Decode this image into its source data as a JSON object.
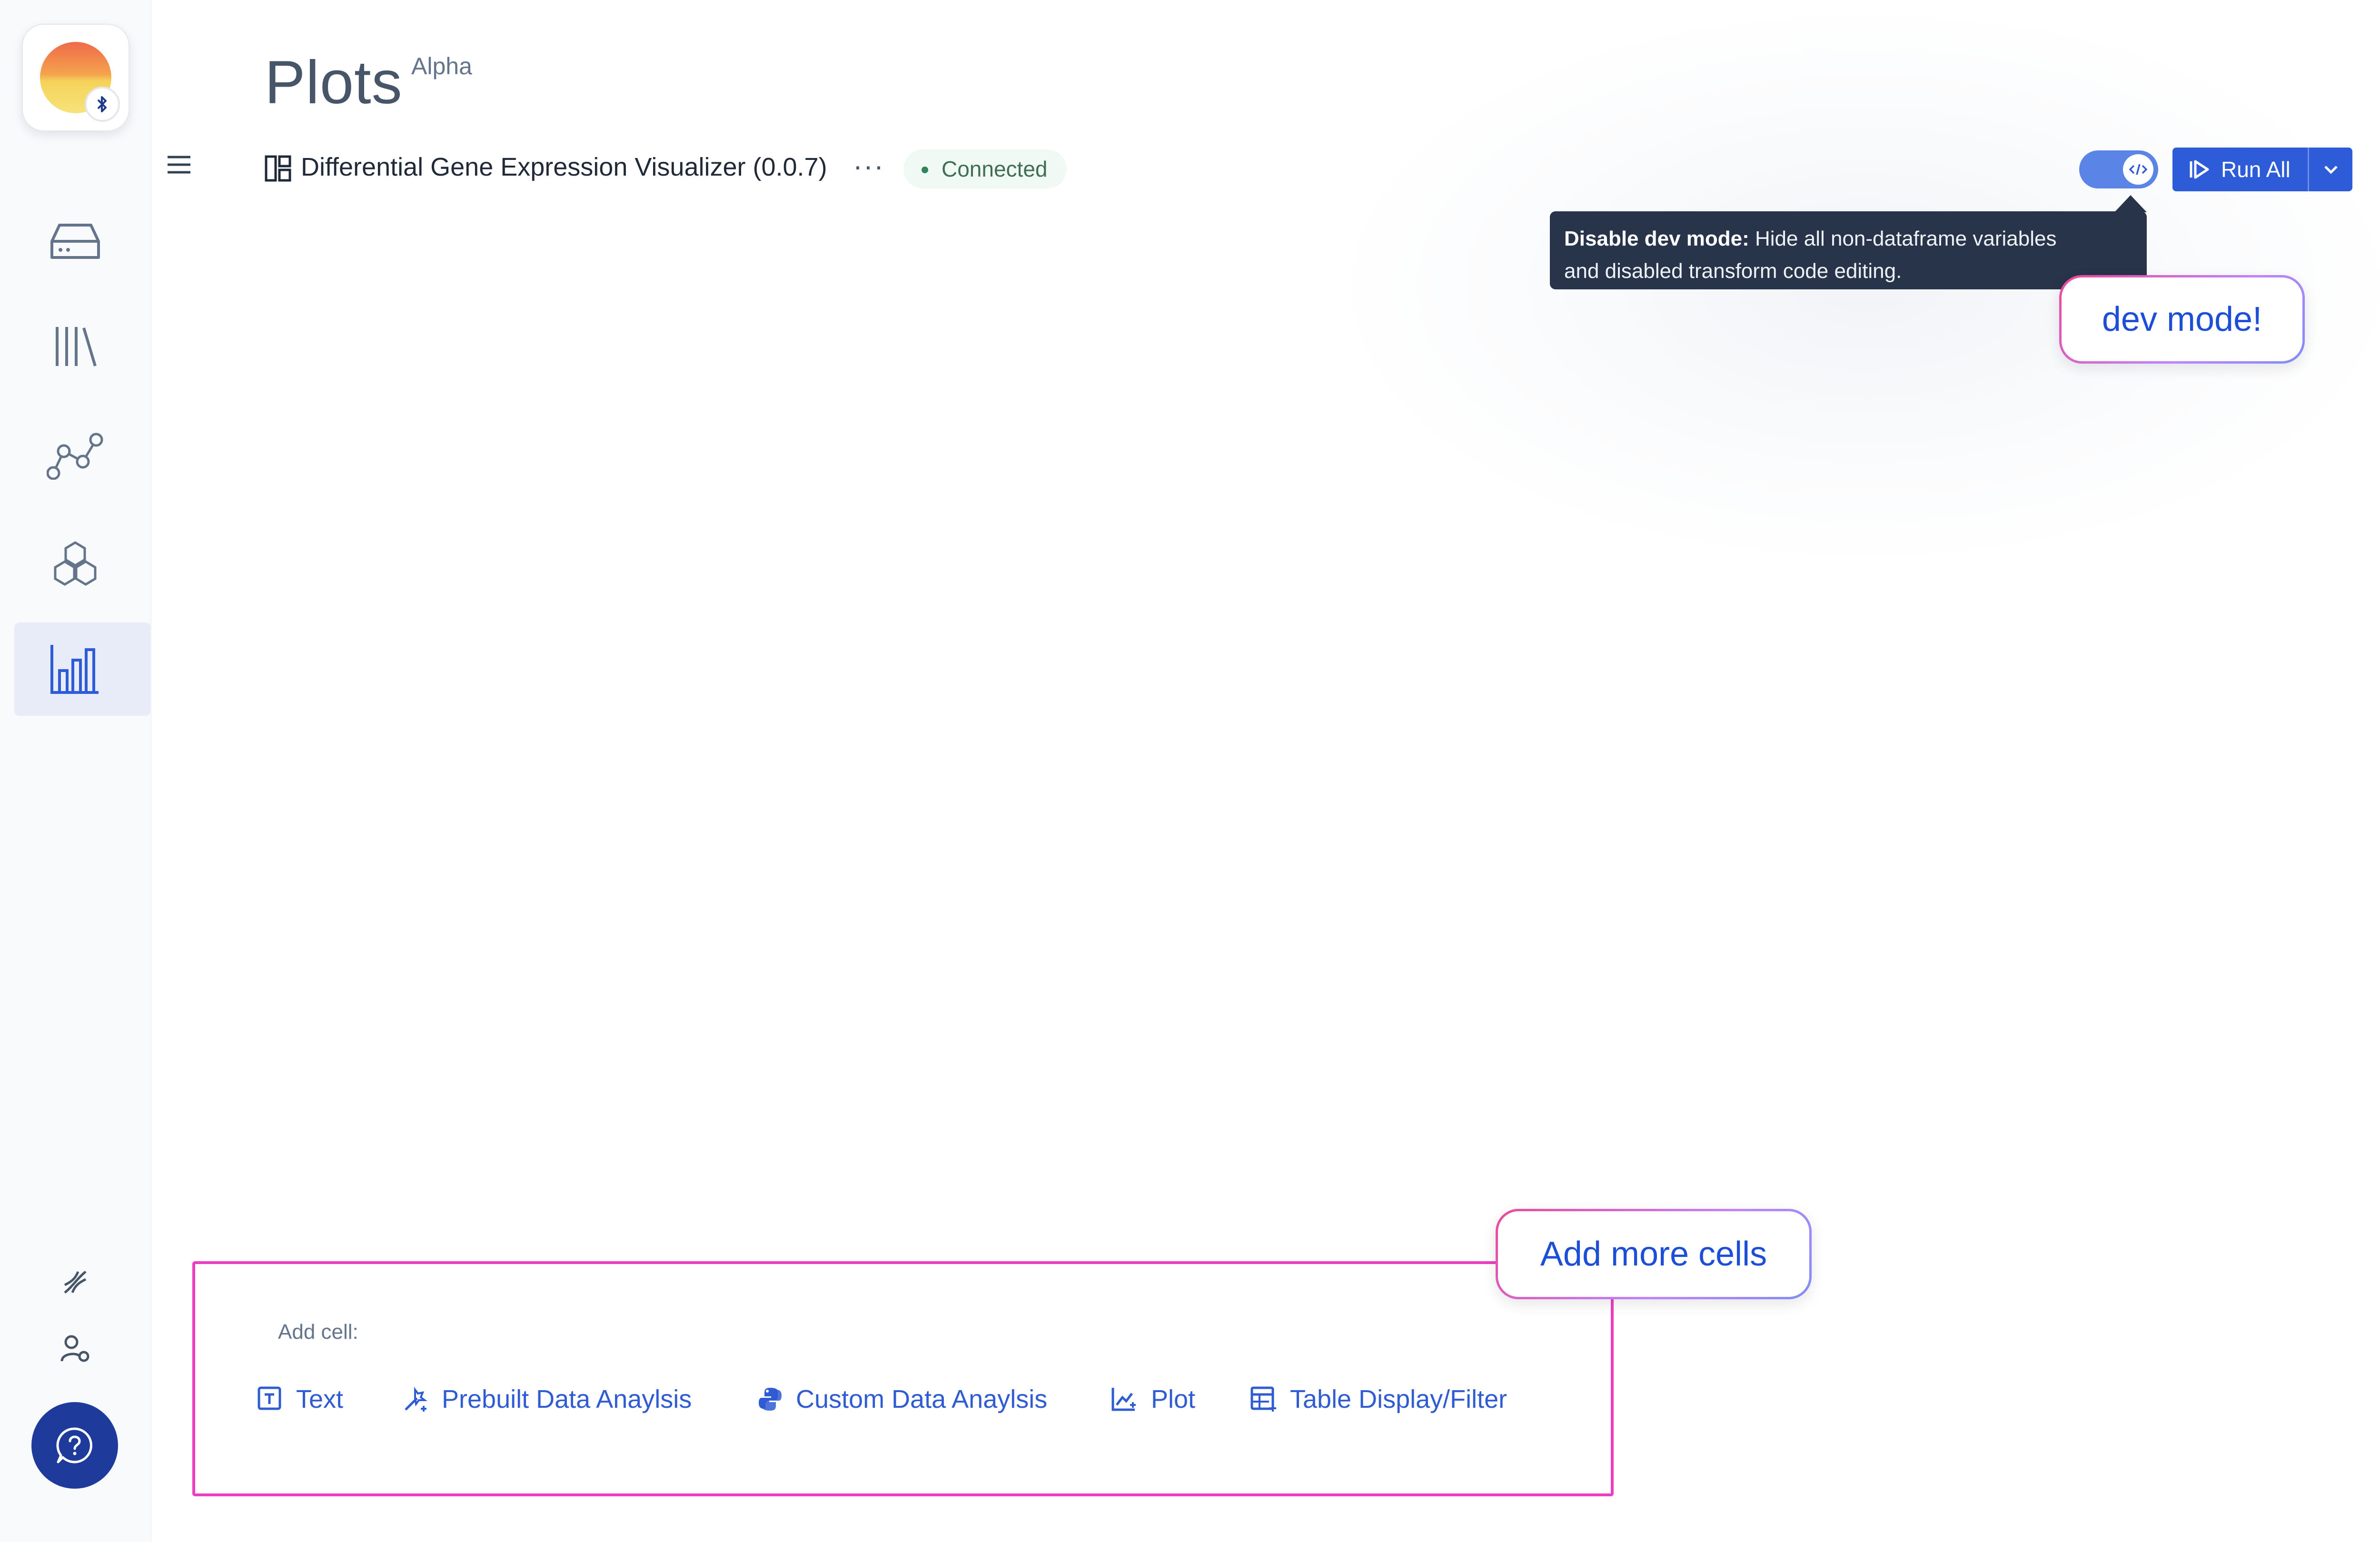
{
  "header": {
    "title": "Plots",
    "badge": "Alpha"
  },
  "notebook": {
    "name": "Differential Gene Expression Visualizer (0.0.7)",
    "more_label": "···",
    "status": "Connected"
  },
  "toolbar": {
    "dev_toggle_on": true,
    "run_all_label": "Run All"
  },
  "tooltip": {
    "title": "Disable dev mode:",
    "text_line1": " Hide all non-dataframe variables",
    "text_line2": "and disabled transform code editing."
  },
  "callouts": {
    "dev_mode": "dev mode!",
    "add_cells": "Add more cells"
  },
  "add_cell": {
    "label": "Add cell:",
    "options": [
      {
        "label": "Text",
        "icon": "text-icon"
      },
      {
        "label": "Prebuilt Data Anaylsis",
        "icon": "wand-icon"
      },
      {
        "label": "Custom Data Anaylsis",
        "icon": "python-icon"
      },
      {
        "label": "Plot",
        "icon": "plot-icon"
      },
      {
        "label": "Table Display/Filter",
        "icon": "table-icon"
      }
    ]
  },
  "sidebar": {
    "items": [
      {
        "name": "data",
        "icon": "drive-icon"
      },
      {
        "name": "registry",
        "icon": "library-icon"
      },
      {
        "name": "workflows",
        "icon": "graph-icon"
      },
      {
        "name": "pods",
        "icon": "hexagons-icon"
      },
      {
        "name": "plots",
        "icon": "bar-chart-icon",
        "active": true
      }
    ],
    "bottom": [
      {
        "name": "dna",
        "icon": "dna-icon"
      },
      {
        "name": "account",
        "icon": "user-settings-icon"
      },
      {
        "name": "help",
        "icon": "help-chat-icon"
      }
    ]
  },
  "colors": {
    "accent": "#2e5bd8",
    "callout_border": "#ec3fbf",
    "tooltip_bg": "#273449",
    "status_green": "#2f855a"
  }
}
